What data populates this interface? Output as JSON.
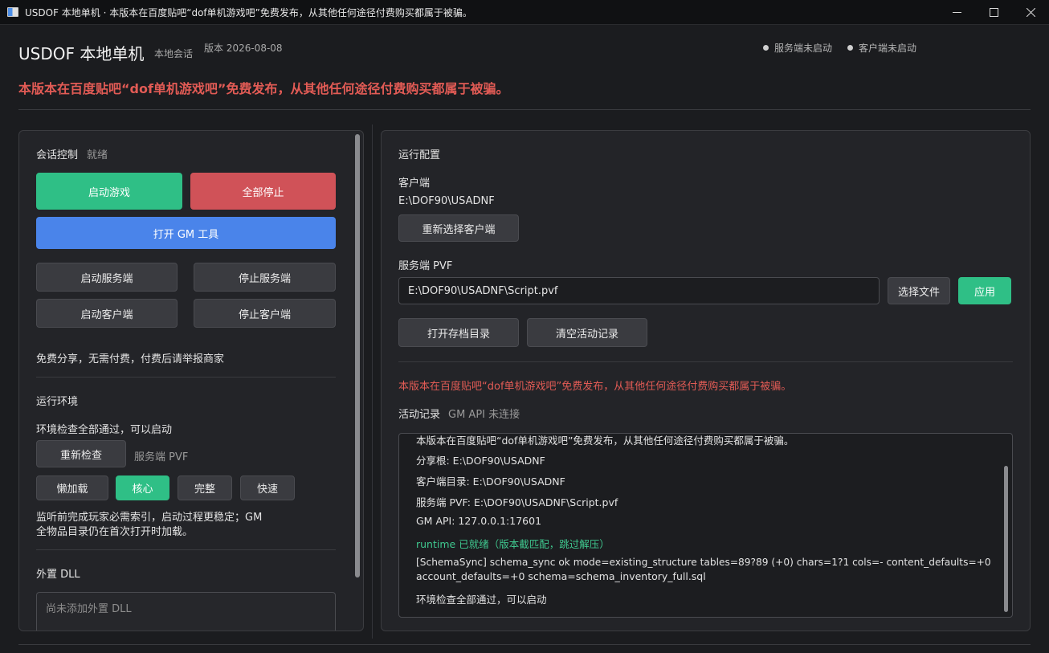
{
  "window": {
    "title": "USDOF 本地单机 · 本版本在百度贴吧“dof单机游戏吧”免费发布，从其他任何途径付费购买都属于被骗。"
  },
  "header": {
    "app_title": "USDOF 本地单机",
    "subtitle": "本地会话",
    "version": "版本 2026-08-08",
    "server_status": "服务端未启动",
    "client_status": "客户端未启动",
    "notice": "本版本在百度贴吧“dof单机游戏吧”免费发布，从其他任何途径付费购买都属于被骗。"
  },
  "left": {
    "session_title": "会话控制",
    "session_state": "就绪",
    "start_game": "启动游戏",
    "stop_all": "全部停止",
    "open_gm": "打开 GM 工具",
    "start_server": "启动服务端",
    "stop_server": "停止服务端",
    "start_client": "启动客户端",
    "stop_client": "停止客户端",
    "free_note": "免费分享，无需付费，付费后请举报商家",
    "env_title": "运行环境",
    "env_status": "环境检查全部通过，可以启动",
    "recheck": "重新检查",
    "pvf_label": "服务端 PVF",
    "mode_lazy": "懒加载",
    "mode_core": "核心",
    "mode_full": "完整",
    "mode_fast": "快速",
    "mode_desc_1": "监听前完成玩家必需索引，启动过程更稳定；GM",
    "mode_desc_2": "全物品目录仍在首次打开时加载。",
    "dll_title": "外置 DLL",
    "dll_placeholder": "尚未添加外置 DLL"
  },
  "right": {
    "config_title": "运行配置",
    "client_label": "客户端",
    "client_path": "E:\\DOF90\\USADNF",
    "reselect_client": "重新选择客户端",
    "pvf_label": "服务端 PVF",
    "pvf_path": "E:\\DOF90\\USADNF\\Script.pvf",
    "choose_file": "选择文件",
    "apply": "应用",
    "open_save_dir": "打开存档目录",
    "clear_log": "清空活动记录",
    "notice": "本版本在百度贴吧“dof单机游戏吧”免费发布，从其他任何途径付费购买都属于被骗。",
    "log_title": "活动记录",
    "gm_api_status": "GM API 未连接",
    "log": [
      "本版本在百度贴吧“dof单机游戏吧”免费发布，从其他任何途径付费购买都属于被骗。",
      "分享根: E:\\DOF90\\USADNF",
      "客户端目录: E:\\DOF90\\USADNF",
      "服务端 PVF: E:\\DOF90\\USADNF\\Script.pvf",
      "GM API: 127.0.0.1:17601",
      "runtime 已就绪（版本截匹配，跳过解压）",
      "[SchemaSync] schema_sync ok mode=existing_structure tables=89?89 (+0) chars=1?1 cols=- content_defaults=+0",
      "account_defaults=+0 schema=schema_inventory_full.sql",
      "环境检查全部通过，可以启动"
    ]
  },
  "colors": {
    "accent_green": "#2fbf86",
    "accent_red": "#d05258",
    "accent_blue": "#4a84ea",
    "notice_red": "#e25b55"
  }
}
